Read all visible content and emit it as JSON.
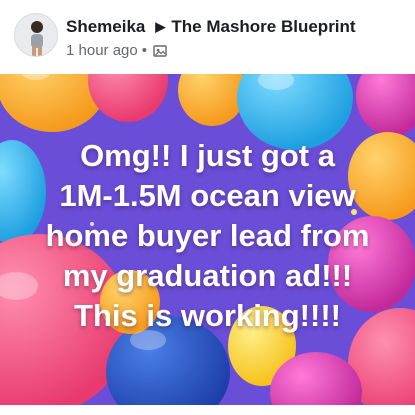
{
  "post": {
    "author": "Shemeika",
    "group": "The Mashore Blueprint",
    "timestamp": "1 hour ago",
    "separator": "•",
    "privacy_icon": "album-icon"
  },
  "image": {
    "caption_lines": [
      "Omg!! I just got a",
      "1M-1.5M ocean view",
      "home buyer lead from",
      "my graduation ad!!!",
      "This  is working!!!!"
    ]
  },
  "colors": {
    "author_text": "#1c1e21",
    "meta_text": "#65676b",
    "caption_text": "#ffffff",
    "background": "#6b4ad6"
  }
}
